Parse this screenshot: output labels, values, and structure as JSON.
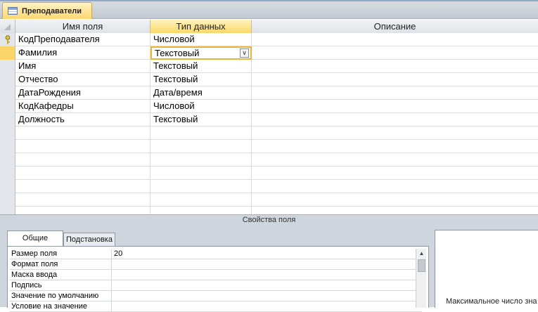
{
  "document_tab": {
    "label": "Преподаватели",
    "icon": "table-icon"
  },
  "grid": {
    "headers": {
      "field_name": "Имя поля",
      "data_type": "Тип данных",
      "description": "Описание"
    },
    "rows": [
      {
        "name": "КодПреподавателя",
        "type": "Числовой",
        "description": "",
        "primary_key": true
      },
      {
        "name": "Фамилия",
        "type": "Текстовый",
        "description": "",
        "current": true
      },
      {
        "name": "Имя",
        "type": "Текстовый",
        "description": ""
      },
      {
        "name": "Отчество",
        "type": "Текстовый",
        "description": ""
      },
      {
        "name": "ДатаРождения",
        "type": "Дата/время",
        "description": ""
      },
      {
        "name": "КодКафедры",
        "type": "Числовой",
        "description": ""
      },
      {
        "name": "Должность",
        "type": "Текстовый",
        "description": ""
      }
    ]
  },
  "field_properties": {
    "title": "Свойства поля",
    "tabs": [
      "Общие",
      "Подстановка"
    ],
    "active_tab": "Общие",
    "rows": [
      {
        "label": "Размер поля",
        "value": "20"
      },
      {
        "label": "Формат поля",
        "value": ""
      },
      {
        "label": "Маска ввода",
        "value": ""
      },
      {
        "label": "Подпись",
        "value": ""
      },
      {
        "label": "Значение по умолчанию",
        "value": ""
      },
      {
        "label": "Условие на значение",
        "value": ""
      }
    ],
    "hint_text": "Максимальное число зна"
  },
  "colors": {
    "active_highlight": "#fcd56a",
    "tab_gold": "#ffd772",
    "panel_bg": "#cfd5dc"
  }
}
